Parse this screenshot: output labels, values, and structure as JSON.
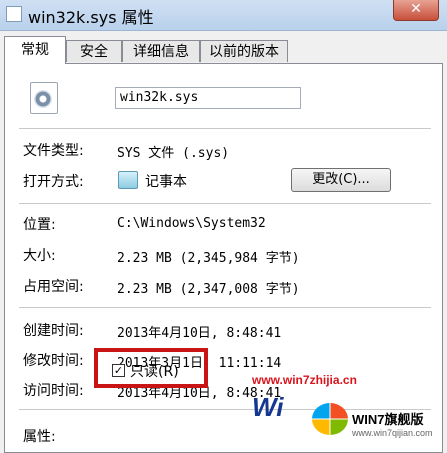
{
  "window": {
    "title": "win32k.sys 属性",
    "close_glyph": "✕"
  },
  "tabs": [
    {
      "label": "常规",
      "active": true
    },
    {
      "label": "安全",
      "active": false
    },
    {
      "label": "详细信息",
      "active": false
    },
    {
      "label": "以前的版本",
      "active": false
    }
  ],
  "general": {
    "file_name": "win32k.sys",
    "file_type_label": "文件类型:",
    "file_type_value": "SYS 文件 (.sys)",
    "open_with_label": "打开方式:",
    "open_with_value": "记事本",
    "change_button": "更改(C)...",
    "location_label": "位置:",
    "location_value": "C:\\Windows\\System32",
    "size_label": "大小:",
    "size_value": "2.23 MB (2,345,984 字节)",
    "disk_size_label": "占用空间:",
    "disk_size_value": "2.23 MB (2,347,008 字节)",
    "created_label": "创建时间:",
    "created_value": "2013年4月10日, 8:48:41",
    "modified_label": "修改时间:",
    "modified_value": "2013年3月1日, 11:11:14",
    "accessed_label": "访问时间:",
    "accessed_value": "2013年4月10日, 8:48:41",
    "attributes_label": "属性:",
    "readonly_label": "只读(R)",
    "readonly_checked": "✓"
  },
  "watermark": {
    "url": "www.win7zhijia.cn",
    "logo": "Wi",
    "badge": "WIN7旗舰版",
    "badge_sub": "www.win7qijian.com"
  },
  "icons": [
    "file-sys-icon",
    "notepad-icon",
    "windows-flag-icon"
  ]
}
